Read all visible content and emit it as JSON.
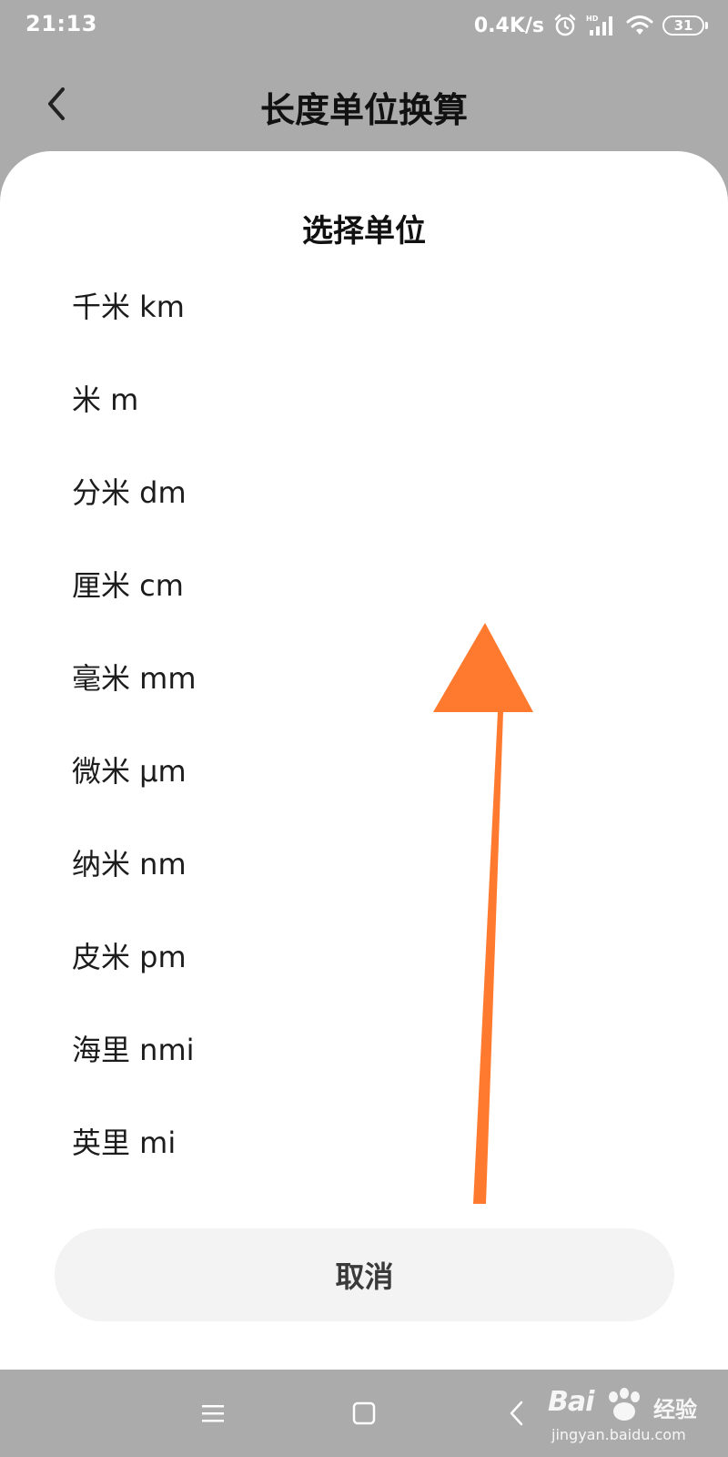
{
  "status_bar": {
    "time": "21:13",
    "net_speed": "0.4K/s",
    "battery_level": "31",
    "icons": [
      "alarm-icon",
      "hd-signal-icon",
      "wifi-icon",
      "battery-icon"
    ]
  },
  "header": {
    "title": "长度单位换算",
    "back_icon": "back-chevron-icon"
  },
  "sheet": {
    "title": "选择单位",
    "units": [
      {
        "label": "千米 km"
      },
      {
        "label": "米 m"
      },
      {
        "label": "分米 dm"
      },
      {
        "label": "厘米 cm"
      },
      {
        "label": "毫米 mm"
      },
      {
        "label": "微米 μm"
      },
      {
        "label": "纳米 nm"
      },
      {
        "label": "皮米 pm"
      },
      {
        "label": "海里 nmi"
      },
      {
        "label": "英里 mi"
      }
    ],
    "cancel_label": "取消"
  },
  "annotation": {
    "arrow_color": "#ff7a2e",
    "direction": "up"
  },
  "nav_bar": {
    "icons": [
      "menu-icon",
      "home-square-icon",
      "back-icon"
    ]
  },
  "watermark": {
    "logo": "Bai",
    "suffix": "经验",
    "url": "jingyan.baidu.com"
  },
  "colors": {
    "backdrop": "#ababab",
    "sheet": "#ffffff",
    "cancel_bg": "#f3f3f3"
  }
}
